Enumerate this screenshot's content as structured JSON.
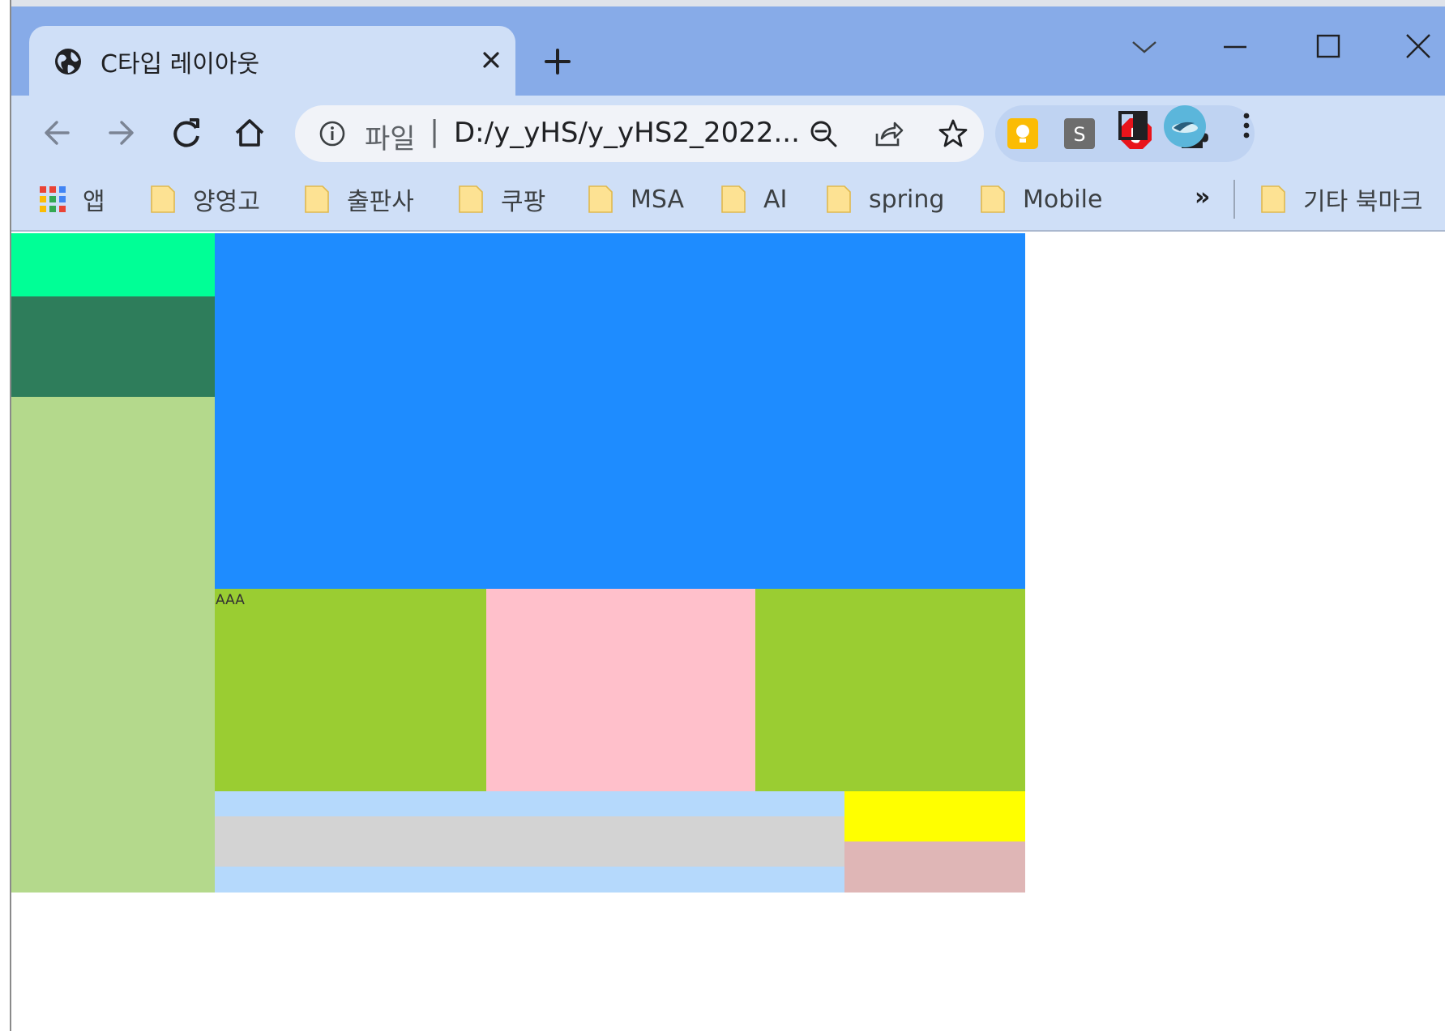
{
  "window": {
    "tab_title": "C타입 레이아웃",
    "favicon": "globe-icon"
  },
  "toolbar": {
    "scheme_label": "파일",
    "url": "D:/y_yHS/y_yHS2_2022..."
  },
  "bookmarks": [
    {
      "label": "앱",
      "icon": "apps-grid-icon"
    },
    {
      "label": "양영고",
      "icon": "folder-icon"
    },
    {
      "label": "출판사",
      "icon": "folder-icon"
    },
    {
      "label": "쿠팡",
      "icon": "folder-icon"
    },
    {
      "label": "MSA",
      "icon": "folder-icon"
    },
    {
      "label": "AI",
      "icon": "folder-icon"
    },
    {
      "label": "spring",
      "icon": "folder-icon"
    },
    {
      "label": "Mobile",
      "icon": "folder-icon"
    }
  ],
  "bookmarks_more": "»",
  "other_bookmarks": "기타 북마크",
  "page": {
    "colors": {
      "side_top": "#00ff96",
      "side_mid": "#2e7d5b",
      "side_bottom": "#b4d98c",
      "main": "#1e8cff",
      "green": "#9acd32",
      "pink": "#ffc0cb",
      "light_blue": "#b5d9fc",
      "gray": "#d3d3d3",
      "yellow": "#ffff00",
      "rosy": "#dfb6b6"
    },
    "box_label": "AAA"
  }
}
